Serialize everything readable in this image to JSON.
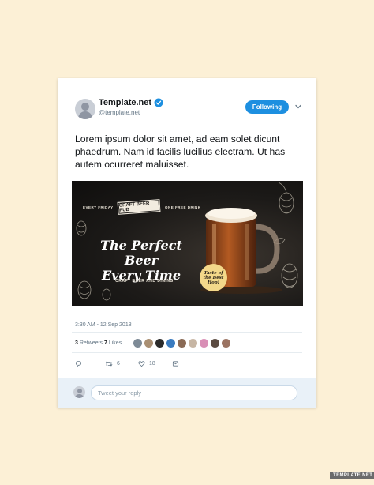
{
  "tweet": {
    "user": {
      "display_name": "Template.net",
      "handle": "@template.net",
      "verified": true
    },
    "follow_button_label": "Following",
    "text": "Lorem ipsum dolor sit amet, ad eam solet dicunt phaedrum. Nam id facilis lucilius electram. Ut has autem ocurreret maluisset.",
    "banner": {
      "top_left": "EVERY FRIDAY",
      "badge": "CRAFT BEER PUB",
      "top_right": "ONE FREE DRINK",
      "headline_line1": "The Perfect Beer",
      "headline_line2": "Every Time",
      "subline": "CRAFT BEER AND DINING",
      "sticker": "Taste of the Best Hop!"
    },
    "timestamp": "3:30 AM - 12 Sep 2018",
    "stats": {
      "retweets_count": "3",
      "retweets_label": "Retweets",
      "likes_count": "7",
      "likes_label": "Likes"
    },
    "actions": {
      "reply_icon": "reply-icon",
      "retweet_icon": "retweet-icon",
      "retweet_count": "6",
      "like_icon": "heart-icon",
      "like_count": "18",
      "dm_icon": "message-icon"
    },
    "reply_placeholder": "Tweet your reply"
  },
  "watermark": "TEMPLATE.NET",
  "colors": {
    "background": "#fcf0d6",
    "accent": "#1d8fe0",
    "reply_bar": "#e9f1f8"
  }
}
